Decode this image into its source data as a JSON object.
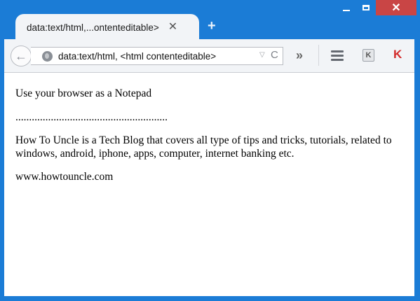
{
  "browser": {
    "tab_title": "data:text/html,...ontenteditable>",
    "tab_close_glyph": "✕",
    "new_tab_glyph": "+",
    "url": "data:text/html, <html contenteditable>",
    "window_controls": {
      "minimize": "minimize",
      "maximize": "maximize",
      "close": "✕"
    }
  },
  "toolbar": {
    "back_glyph": "←",
    "reload_glyph": "C",
    "overflow_glyph": "»",
    "k_label": "K",
    "kav_label": "K"
  },
  "content": {
    "line1": "Use your browser as a Notepad",
    "line2": "........................................................",
    "line3": "How To Uncle is a Tech Blog that covers all type of tips and tricks, tutorials, related to windows, android, iphone, apps, computer, internet banking etc.",
    "line4": "www.howtouncle.com"
  },
  "colors": {
    "frame": "#1b7cd6",
    "close_button": "#c94545",
    "kaspersky": "#d32b2b"
  }
}
